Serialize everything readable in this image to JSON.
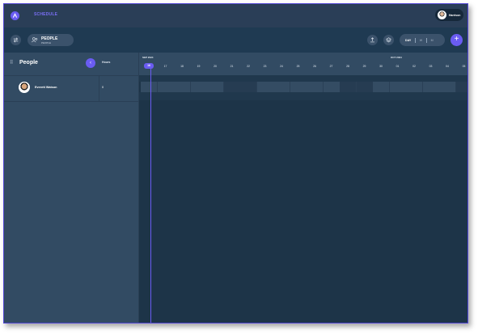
{
  "nav": {
    "brand_icon": "app-logo-icon",
    "schedule_label": "SCHEDULE",
    "user_name": "Harrison"
  },
  "toolbar": {
    "people_title": "PEOPLE",
    "people_sub": "PEOPLE",
    "view_day": "DAY",
    "view_week": "W",
    "view_month": "M",
    "add_label": "+"
  },
  "panel": {
    "title": "People",
    "hours_header": "Hours",
    "collapse_label": "‹",
    "rows": [
      {
        "name": "Everett Watson",
        "hours": "0"
      }
    ]
  },
  "timeline": {
    "months": [
      "SEP 2024",
      "OCT 2024"
    ],
    "days": [
      "16",
      "17",
      "18",
      "19",
      "20",
      "21",
      "22",
      "23",
      "24",
      "25",
      "26",
      "27",
      "28",
      "29",
      "30",
      "01",
      "02",
      "03",
      "04",
      "05"
    ],
    "today": "16"
  },
  "colors": {
    "accent": "#6a5cf2",
    "background": "#1c3449",
    "panel": "#324b63"
  }
}
